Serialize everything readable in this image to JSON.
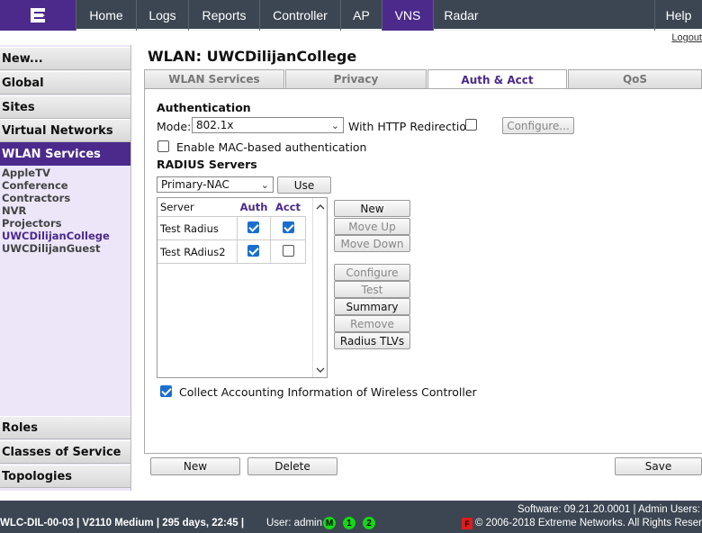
{
  "nav": {
    "items": [
      "Home",
      "Logs",
      "Reports",
      "Controller",
      "AP",
      "VNS",
      "Radar",
      "Help"
    ],
    "active": "VNS",
    "logout": "Logout"
  },
  "sidebar": {
    "new": "New...",
    "global": "Global",
    "sites": "Sites",
    "virtual_networks": "Virtual Networks",
    "wlan_services": "WLAN Services",
    "wlan_list": [
      "AppleTV",
      "Conference",
      "Contractors",
      "NVR",
      "Projectors",
      "UWCDilijanCollege",
      "UWCDilijanGuest"
    ],
    "selected_wlan": "UWCDilijanCollege",
    "roles": "Roles",
    "classes_of_service": "Classes of Service",
    "topologies": "Topologies"
  },
  "page": {
    "title": "WLAN: UWCDilijanCollege",
    "tabs": [
      "WLAN Services",
      "Privacy",
      "Auth & Acct",
      "QoS"
    ],
    "active_tab": "Auth & Acct"
  },
  "auth": {
    "section_title": "Authentication",
    "mode_label": "Mode:",
    "mode_value": "802.1x",
    "http_redirect_label": "With HTTP Redirection",
    "http_redirect_checked": false,
    "configure_label": "Configure...",
    "mac_auth_label": "Enable MAC-based authentication",
    "mac_auth_checked": false,
    "radius_title": "RADIUS Servers",
    "server_select_value": "Primary-NAC",
    "use_label": "Use",
    "table_headers": [
      "Server",
      "Auth",
      "Acct"
    ],
    "servers": [
      {
        "name": "Test Radius",
        "auth": true,
        "acct": true
      },
      {
        "name": "Test RAdius2",
        "auth": true,
        "acct": false
      }
    ],
    "buttons": {
      "new": "New",
      "move_up": "Move Up",
      "move_down": "Move Down",
      "configure": "Configure",
      "test": "Test",
      "summary": "Summary",
      "remove": "Remove",
      "radius_tlvs": "Radius TLVs"
    },
    "collect_label": "Collect Accounting Information of Wireless Controller",
    "collect_checked": true
  },
  "footer_buttons": {
    "new": "New",
    "delete": "Delete",
    "save": "Save"
  },
  "statusbar": {
    "controller": "WLC-DIL-00-03 | V2110 Medium | 295 days, 22:45 |",
    "user": "User: admin",
    "badges": [
      "M",
      "1",
      "2"
    ],
    "software": "Software: 09.21.20.0001 | Admin Users: 2",
    "copyright": "© 2006-2018  Extreme Networks. All Rights Reserved",
    "alarm_icon": "F"
  },
  "colors": {
    "brand": "#4b2a8c",
    "nav_bg": "#3b4652",
    "status_green": "#17d617"
  }
}
